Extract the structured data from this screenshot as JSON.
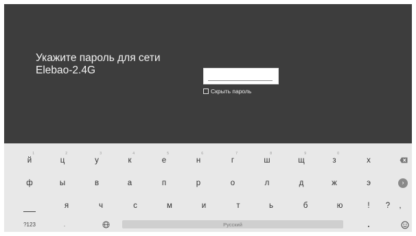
{
  "prompt": {
    "line1": "Укажите пароль для сети",
    "line2": "Elebao-2.4G"
  },
  "password": {
    "value": "",
    "hide_label": "Скрыть пароль",
    "hide_checked": false
  },
  "keyboard": {
    "row1": [
      "й",
      "ц",
      "у",
      "к",
      "е",
      "н",
      "г",
      "ш",
      "щ",
      "з",
      "х"
    ],
    "row1_hints": [
      "1",
      "2",
      "3",
      "4",
      "5",
      "6",
      "7",
      "8",
      "9",
      "0"
    ],
    "row2": [
      "ф",
      "ы",
      "в",
      "а",
      "п",
      "р",
      "о",
      "л",
      "д",
      "ж",
      "э"
    ],
    "row3": [
      "я",
      "ч",
      "с",
      "м",
      "и",
      "т",
      "ь",
      "б",
      "ю",
      "!",
      "?",
      ","
    ],
    "row4": {
      "mode_key": "?123",
      "period_small": ".",
      "space_label": "Русский",
      "period": "."
    },
    "icons": {
      "backspace": "backspace-icon",
      "go": "arrow-right-icon",
      "shift": "shift-icon",
      "globe": "globe-icon",
      "emoji": "emoji-icon"
    }
  },
  "colors": {
    "screen_bg": "#3d3d3d",
    "keyboard_bg": "#e8e8e8",
    "key_text": "#333333"
  }
}
